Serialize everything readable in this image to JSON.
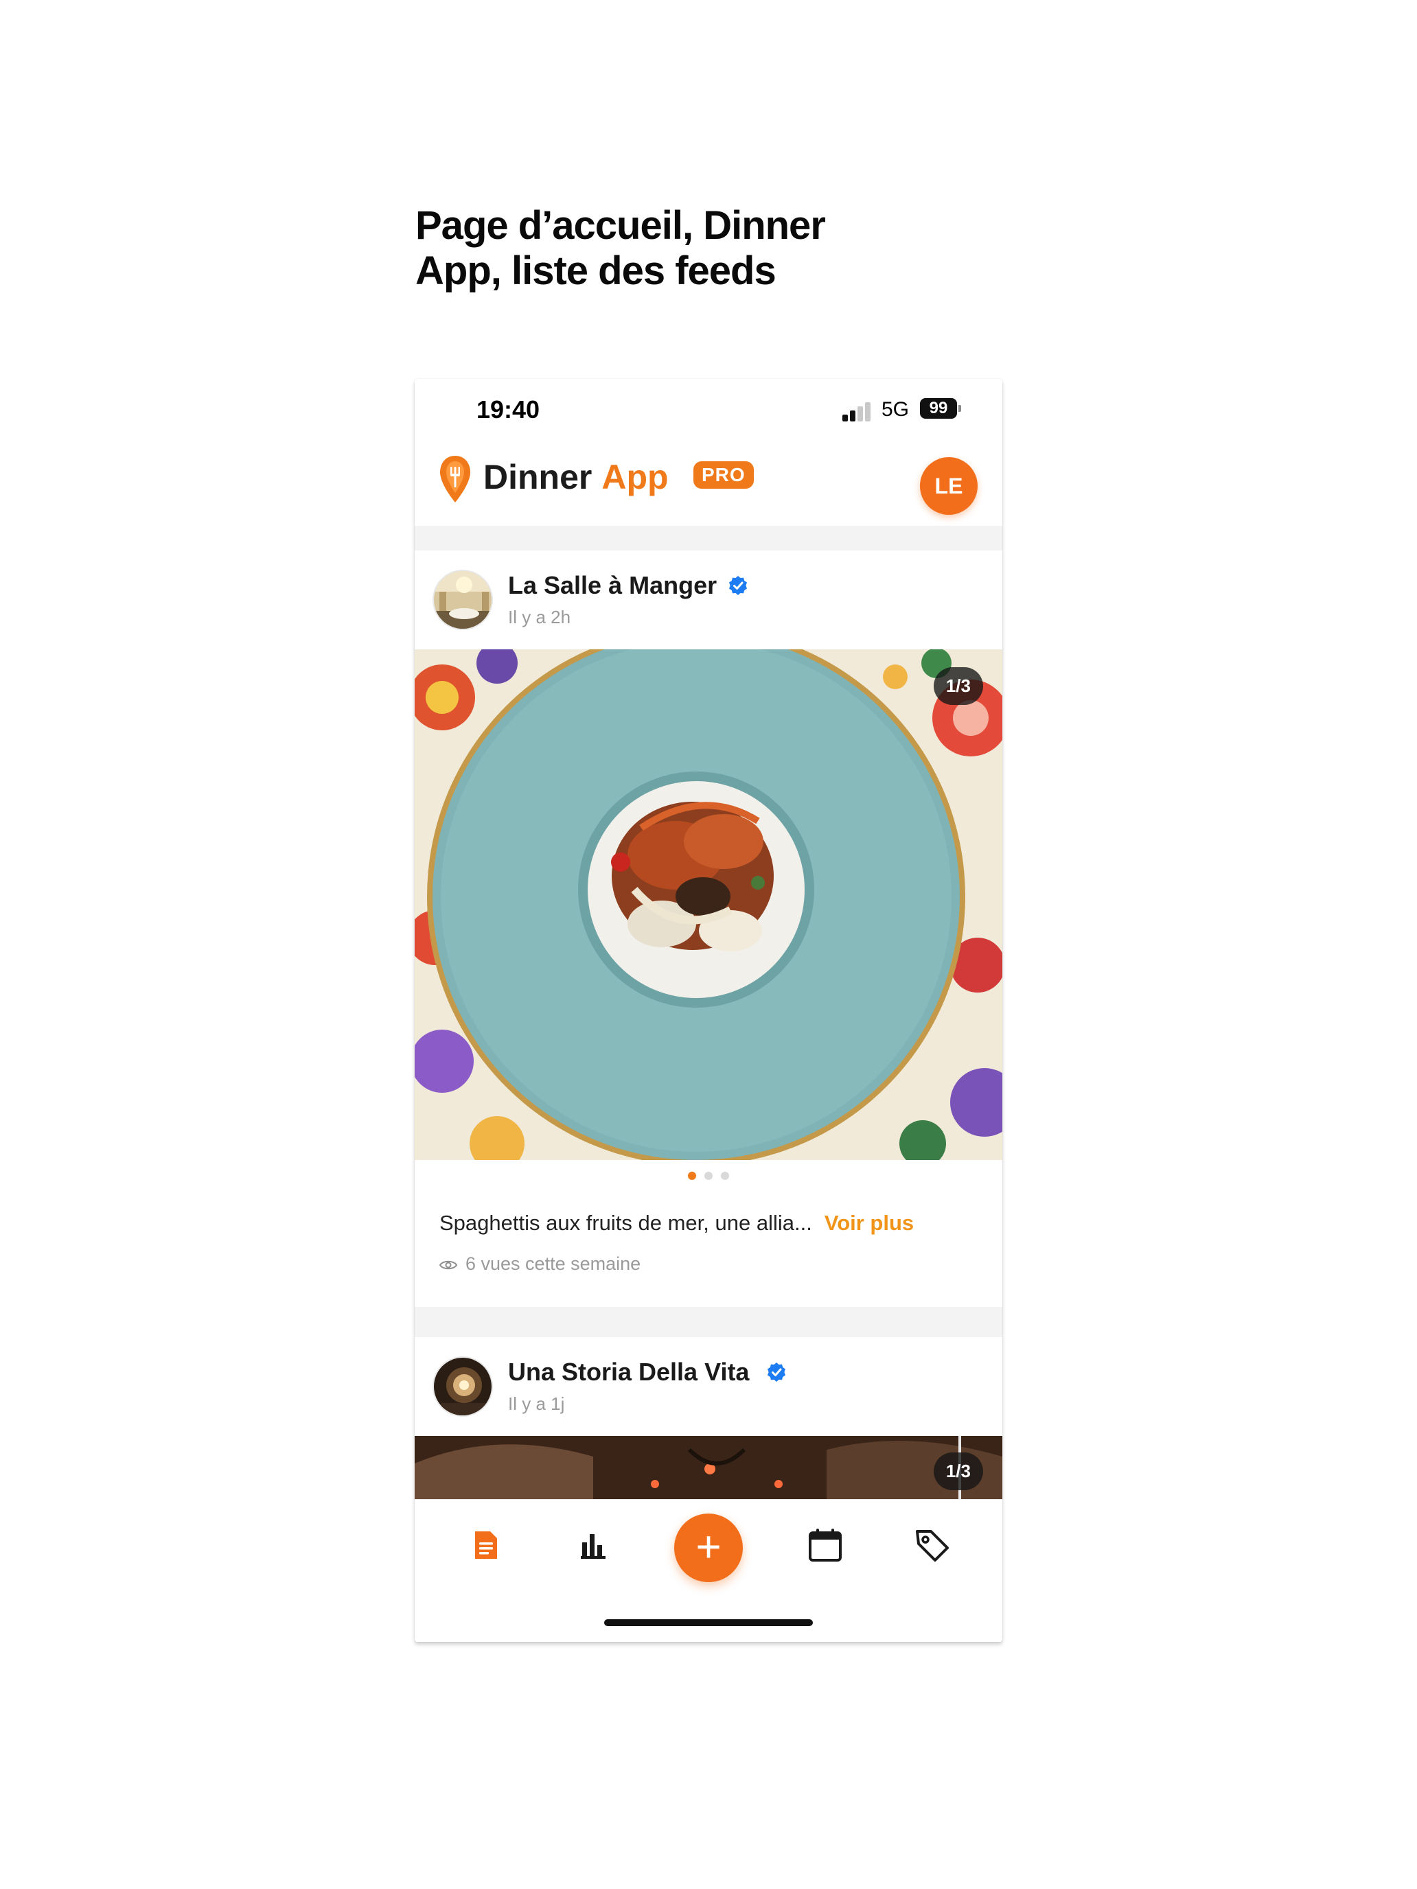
{
  "page": {
    "title_line1": "Page d’accueil, Dinner",
    "title_line2": "App, liste des feeds"
  },
  "status_bar": {
    "time": "19:40",
    "network": "5G",
    "battery": "99"
  },
  "header": {
    "brand_word1": "Dinner",
    "brand_word2": "App",
    "badge": "PRO",
    "user_initials": "LE",
    "brand_color": "#f07a1a"
  },
  "feed": {
    "posts": [
      {
        "author": "La Salle à Manger",
        "time": "Il y a 2h",
        "slide_counter": "1/3",
        "caption": "Spaghettis aux fruits de mer, une allia...",
        "more_label": "Voir plus",
        "views": "6 vues cette semaine",
        "verified_icon": "verified-check-icon"
      },
      {
        "author": "Una Storia Della Vita",
        "time": "Il y a 1j",
        "slide_counter": "1/3",
        "verified_icon": "verified-check-icon"
      }
    ]
  },
  "bottom_nav": {
    "items": [
      {
        "icon": "document-icon",
        "active": true
      },
      {
        "icon": "bar-chart-icon",
        "active": false
      },
      {
        "icon": "plus-icon",
        "label": "+"
      },
      {
        "icon": "calendar-icon",
        "active": false
      },
      {
        "icon": "tag-icon",
        "active": false
      }
    ],
    "active_color": "#f26e1b"
  }
}
